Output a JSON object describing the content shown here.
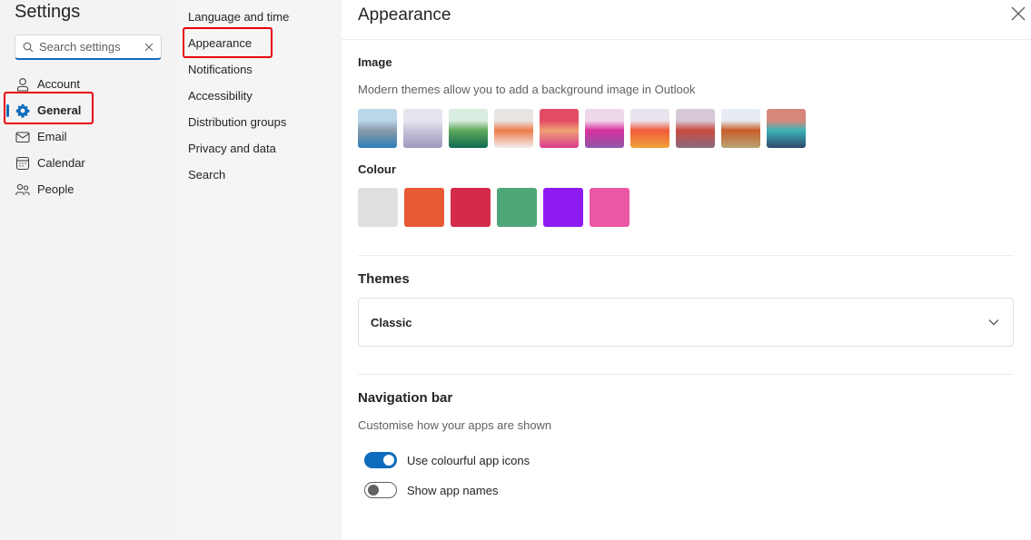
{
  "nav": {
    "title": "Settings",
    "search": {
      "placeholder": "Search settings",
      "value": ""
    },
    "items": [
      {
        "label": "Account",
        "icon": "person-icon",
        "active": false
      },
      {
        "label": "General",
        "icon": "gear-icon",
        "active": true
      },
      {
        "label": "Email",
        "icon": "mail-icon",
        "active": false
      },
      {
        "label": "Calendar",
        "icon": "calendar-icon",
        "active": false
      },
      {
        "label": "People",
        "icon": "people-icon",
        "active": false
      }
    ]
  },
  "subnav": {
    "items": [
      {
        "label": "Language and time"
      },
      {
        "label": "Appearance",
        "active": true
      },
      {
        "label": "Notifications"
      },
      {
        "label": "Accessibility"
      },
      {
        "label": "Distribution groups"
      },
      {
        "label": "Privacy and data"
      },
      {
        "label": "Search"
      }
    ]
  },
  "main": {
    "title": "Appearance",
    "image": {
      "label": "Image",
      "description": "Modern themes allow you to add a background image in Outlook",
      "thumbnails": [
        {
          "name": "mountain-lake",
          "colors": [
            "#bcd6ea",
            "#8a9aa8",
            "#2f7fb8"
          ]
        },
        {
          "name": "lavender-dunes",
          "colors": [
            "#e6e4ef",
            "#c9c3da",
            "#9f98bd"
          ]
        },
        {
          "name": "green-shapes",
          "colors": [
            "#d8ecdf",
            "#5fa85c",
            "#0f6b4f"
          ]
        },
        {
          "name": "white-orange-wave",
          "colors": [
            "#e8e4e1",
            "#ef7c4b",
            "#efeeec"
          ]
        },
        {
          "name": "pink-swirl",
          "colors": [
            "#e24c63",
            "#f0a074",
            "#d83e8f"
          ]
        },
        {
          "name": "pink-bubbles",
          "colors": [
            "#efd7ea",
            "#d6309c",
            "#8e58a9"
          ]
        },
        {
          "name": "orange-petals",
          "colors": [
            "#e8e3ec",
            "#ef5b3b",
            "#f3a23b"
          ]
        },
        {
          "name": "red-lake",
          "colors": [
            "#d7c8d6",
            "#c84a3f",
            "#8a6a80"
          ]
        },
        {
          "name": "desert-layers",
          "colors": [
            "#e6ecf2",
            "#c95c2a",
            "#b8a574"
          ]
        },
        {
          "name": "turquoise-arch",
          "colors": [
            "#d6877a",
            "#3bb3b6",
            "#2e4a6c"
          ]
        }
      ]
    },
    "colour": {
      "label": "Colour",
      "swatches": [
        {
          "name": "light-gray",
          "hex": "#e0e0e0"
        },
        {
          "name": "orange",
          "hex": "#e85a34"
        },
        {
          "name": "crimson",
          "hex": "#d52b4b"
        },
        {
          "name": "green",
          "hex": "#4fa679"
        },
        {
          "name": "purple",
          "hex": "#8d1bef"
        },
        {
          "name": "pink",
          "hex": "#ea57a5"
        }
      ]
    },
    "themes": {
      "label": "Themes",
      "selected": "Classic"
    },
    "navigation_bar": {
      "label": "Navigation bar",
      "description": "Customise how your apps are shown",
      "toggles": [
        {
          "label": "Use colourful app icons",
          "on": true
        },
        {
          "label": "Show app names",
          "on": false
        }
      ]
    }
  },
  "colors": {
    "accent": "#0f6cbd",
    "highlight": "#e8000b"
  }
}
